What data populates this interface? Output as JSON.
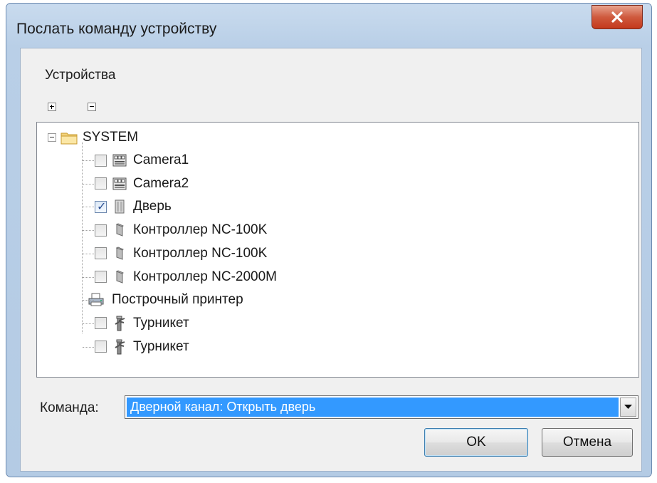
{
  "window": {
    "title": "Послать команду устройству",
    "close_icon": "close-x-icon"
  },
  "group_label": "Устройства",
  "toolbar": {
    "expand_all_icon": "plus-box-icon",
    "collapse_all_icon": "minus-box-icon"
  },
  "tree": {
    "root": {
      "label": "SYSTEM",
      "icon": "folder-icon",
      "expanded": true
    },
    "items": [
      {
        "label": "Camera1",
        "icon": "camera-icon",
        "checked": false,
        "has_checkbox": true
      },
      {
        "label": "Camera2",
        "icon": "camera-icon",
        "checked": false,
        "has_checkbox": true
      },
      {
        "label": "Дверь",
        "icon": "door-icon",
        "checked": true,
        "has_checkbox": true
      },
      {
        "label": "Контроллер NC-100K",
        "icon": "controller-icon",
        "checked": false,
        "has_checkbox": true
      },
      {
        "label": "Контроллер NC-100K",
        "icon": "controller-icon",
        "checked": false,
        "has_checkbox": true
      },
      {
        "label": "Контроллер NC-2000M",
        "icon": "controller-icon",
        "checked": false,
        "has_checkbox": true
      },
      {
        "label": "Построчный принтер",
        "icon": "printer-icon",
        "has_checkbox": false
      },
      {
        "label": "Турникет",
        "icon": "turnstile-icon",
        "checked": false,
        "has_checkbox": true
      },
      {
        "label": "Турникет",
        "icon": "turnstile-icon",
        "checked": false,
        "has_checkbox": true
      }
    ]
  },
  "command": {
    "label": "Команда:",
    "value": "Дверной канал: Открыть дверь"
  },
  "buttons": {
    "ok": "OK",
    "cancel": "Отмена"
  },
  "colors": {
    "selection": "#3399ff",
    "close_button": "#c94a2c"
  }
}
